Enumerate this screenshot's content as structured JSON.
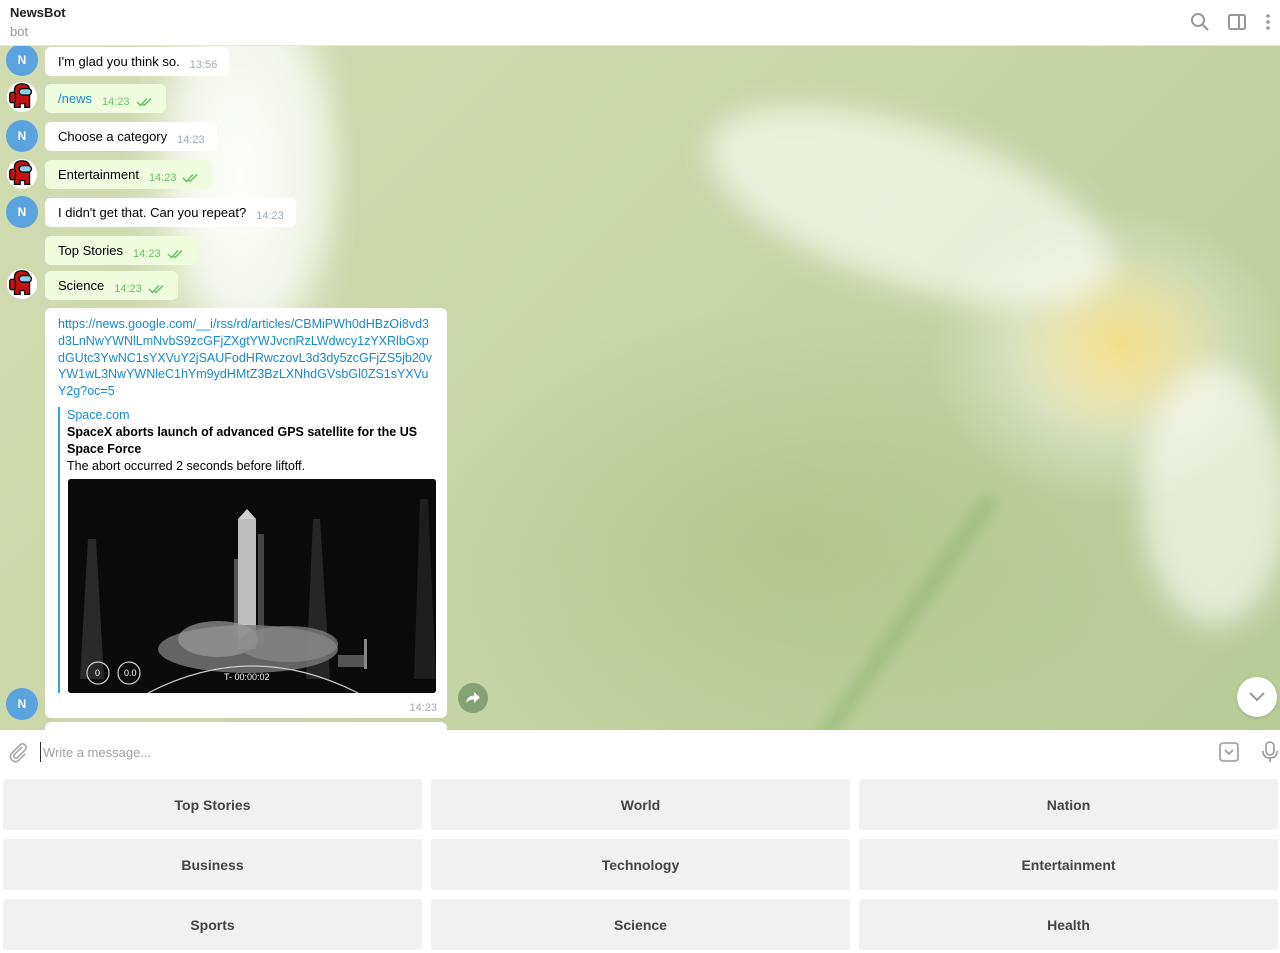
{
  "header": {
    "title": "NewsBot",
    "subtitle": "bot"
  },
  "messages": [
    {
      "dir": "in",
      "avatar": "N",
      "text": "I'm glad you think so.",
      "time": "13:56"
    },
    {
      "dir": "out",
      "avatar": "among-us",
      "text": "/news",
      "time": "14:23",
      "link": true
    },
    {
      "dir": "in",
      "avatar": "N",
      "text": "Choose a category",
      "time": "14:23"
    },
    {
      "dir": "out",
      "avatar": "among-us",
      "text": "Entertainment",
      "time": "14:23"
    },
    {
      "dir": "in",
      "avatar": "N",
      "text": "I didn't get that. Can you repeat?",
      "time": "14:23"
    },
    {
      "dir": "out",
      "avatar": null,
      "text": "Top Stories",
      "time": "14:23"
    },
    {
      "dir": "out",
      "avatar": "among-us",
      "text": "Science",
      "time": "14:23"
    }
  ],
  "card": {
    "avatar": "N",
    "url": "https://news.google.com/__i/rss/rd/articles/CBMiPWh0dHBzOi8vd3d3LnNwYWNlLmNvbS9zcGFjZXgtYWJvcnRzLWdwcy1zYXRlbGxpdGUtc3YwNC1sYXVuY2jSAUFodHRwczovL3d3dy5zcGFjZS5jb20vYW1wL3NwYWNleC1hYm9ydHMtZ3BzLXNhdGVsbGl0ZS1sYXVuY2g?oc=5",
    "site": "Space.com",
    "title": "SpaceX aborts launch of advanced GPS satellite for the US Space Force",
    "description": "The abort occurred 2 seconds before liftoff.",
    "time": "14:23",
    "image_overlay": {
      "speed": "0",
      "altitude": "0.0",
      "countdown": "T- 00:00:02"
    }
  },
  "composer": {
    "placeholder": "Write a message..."
  },
  "keyboard": [
    [
      "Top Stories",
      "World",
      "Nation"
    ],
    [
      "Business",
      "Technology",
      "Entertainment"
    ],
    [
      "Sports",
      "Science",
      "Health"
    ]
  ],
  "colors": {
    "incoming_bubble": "#ffffff",
    "outgoing_bubble": "#effdde",
    "link": "#168acd",
    "avatar": "#5aa3df",
    "check": "#6cc264"
  },
  "icons": [
    "search-icon",
    "sidebar-toggle-icon",
    "more-icon",
    "attach-icon",
    "bot-command-icon",
    "microphone-icon",
    "share-icon",
    "chevron-down-icon"
  ]
}
